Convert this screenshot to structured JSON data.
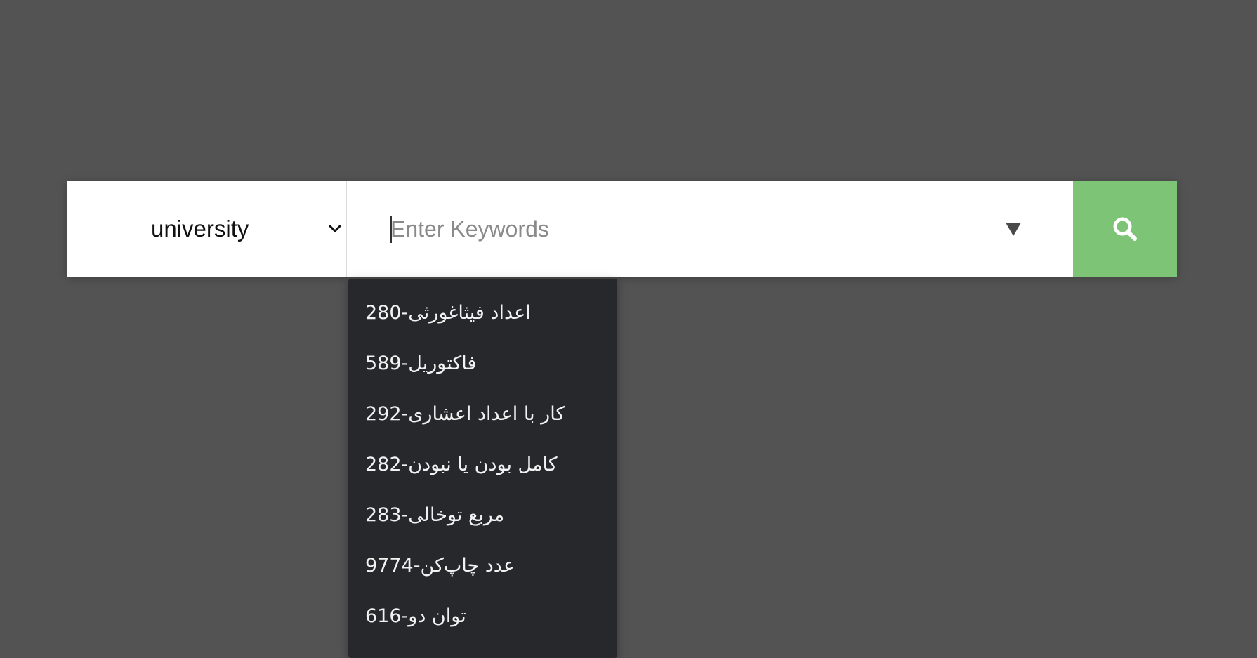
{
  "search": {
    "category": {
      "selected": "university",
      "icon": "chevron-down-icon"
    },
    "keywords": {
      "value": "",
      "placeholder": "Enter Keywords",
      "dropdown_icon": "triangle-down-icon"
    },
    "button": {
      "icon": "search-icon",
      "color": "#7ec476"
    }
  },
  "suggestions": [
    {
      "label": "اعداد فیثاغورثی-280"
    },
    {
      "label": "فاکتوریل-589"
    },
    {
      "label": "کار با اعداد اعشاری-292"
    },
    {
      "label": "کامل بودن یا نبودن-282"
    },
    {
      "label": "مربع توخالی-283"
    },
    {
      "label": "عدد چاپ‌کن-9774"
    },
    {
      "label": "توان دو-616"
    }
  ],
  "colors": {
    "background": "#535353",
    "dropdown_bg": "#27282b",
    "accent": "#7ec476"
  }
}
